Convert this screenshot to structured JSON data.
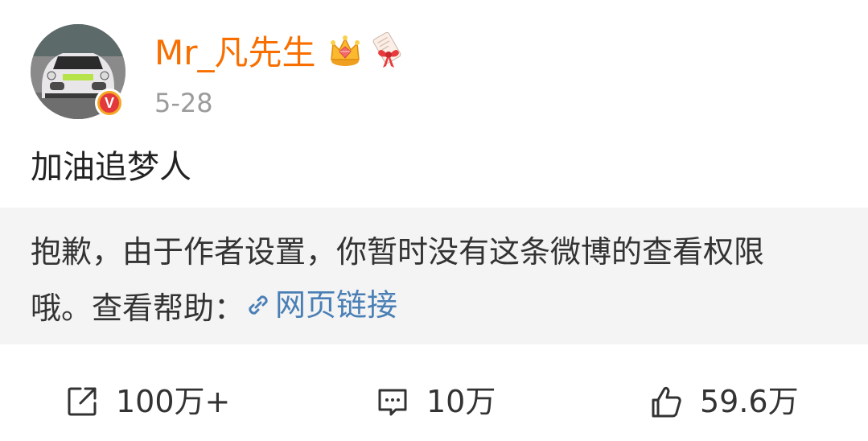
{
  "post": {
    "author": {
      "name": "Mr_凡先生",
      "verified_mark": "V",
      "avatar_icon": "car-avatar-icon",
      "badges": [
        "crown-icon",
        "ribbon-icon"
      ]
    },
    "date": "5-28",
    "text": "加油追梦人",
    "notice": {
      "line1": "抱歉，由于作者设置，你暂时没有这条微博的查看权限",
      "line2_prefix": "哦。查看帮助：",
      "link_label": "网页链接",
      "link_icon": "link-icon"
    },
    "actions": {
      "repost_count": "100万+",
      "comment_count": "10万",
      "like_count": "59.6万",
      "repost_icon": "share-icon",
      "comment_icon": "comment-icon",
      "like_icon": "thumbs-up-icon"
    }
  },
  "colors": {
    "username": "#f86f00",
    "link": "#4a7fb5",
    "notice_bg": "#f4f4f4",
    "date": "#9b9b9b"
  }
}
